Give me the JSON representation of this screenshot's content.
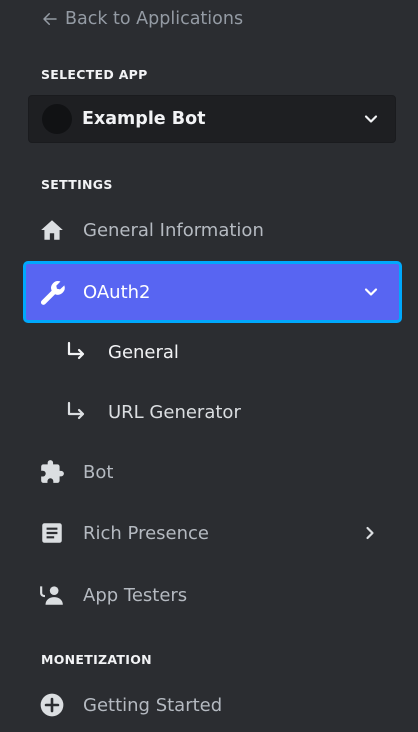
{
  "back_link": "Back to Applications",
  "selected_app": {
    "section_label": "SELECTED APP",
    "app_name": "Example Bot"
  },
  "settings": {
    "section_label": "SETTINGS",
    "items": [
      {
        "label": "General Information",
        "icon": "home-icon"
      },
      {
        "label": "OAuth2",
        "icon": "wrench-icon",
        "active": true,
        "expanded": true
      },
      {
        "label": "Bot",
        "icon": "puzzle-icon"
      },
      {
        "label": "Rich Presence",
        "icon": "document-icon",
        "has_submenu": true
      },
      {
        "label": "App Testers",
        "icon": "user-icon"
      }
    ],
    "oauth2_subitems": [
      {
        "label": "General"
      },
      {
        "label": "URL Generator"
      }
    ]
  },
  "monetization": {
    "section_label": "MONETIZATION",
    "items": [
      {
        "label": "Getting Started",
        "icon": "plus-circle-icon"
      }
    ]
  },
  "colors": {
    "background": "#2b2d31",
    "active_bg": "#5865f2",
    "focus_ring": "#00a8fc"
  }
}
